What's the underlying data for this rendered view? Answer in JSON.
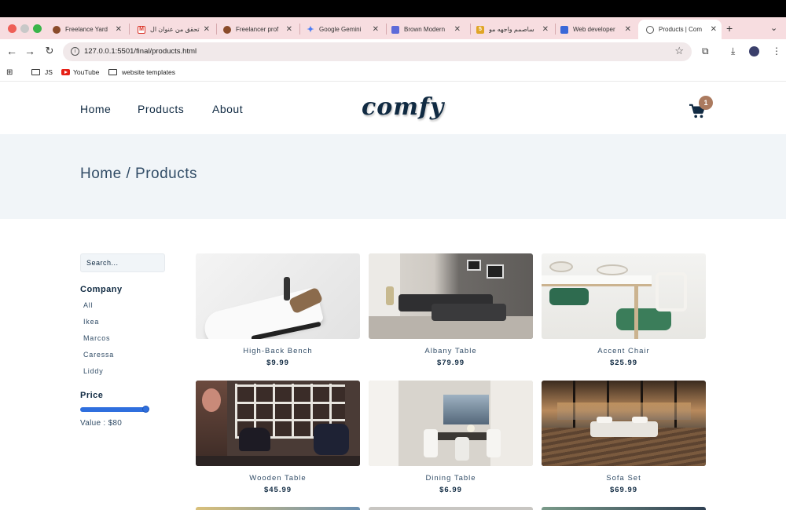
{
  "browser": {
    "tabs": [
      {
        "title": "Freelance Yard",
        "favicon_color": "#8a4b2a"
      },
      {
        "title": "تحقق من عنوان ال",
        "favicon_color": "#d93025"
      },
      {
        "title": "Freelancer prof",
        "favicon_color": "#8a4b2a"
      },
      {
        "title": "Google Gemini",
        "favicon_color": "#4a7cf5"
      },
      {
        "title": "Brown Modern",
        "favicon_color": "#5d6bd9"
      },
      {
        "title": "ساصمم واجهه مو",
        "favicon_color": "#e0a526"
      },
      {
        "title": "Web developer",
        "favicon_color": "#3a68d8"
      },
      {
        "title": "Products | Com",
        "favicon_color": "#555555"
      }
    ],
    "url": "127.0.0.1:5501/final/products.html",
    "bookmarks": [
      "JS",
      "YouTube",
      "website templates"
    ]
  },
  "nav": {
    "links": [
      "Home",
      "Products",
      "About"
    ],
    "logo": "comfy",
    "cart_count": "1"
  },
  "hero": {
    "title": "Home / Products"
  },
  "sidebar": {
    "search_placeholder": "Search...",
    "company_title": "Company",
    "companies": [
      "All",
      "Ikea",
      "Marcos",
      "Caressa",
      "Liddy"
    ],
    "price_title": "Price",
    "price_value": "Value : $80",
    "price_level": 1.0
  },
  "products": [
    {
      "name": "High-Back Bench",
      "price": "$9.99"
    },
    {
      "name": "Albany Table",
      "price": "$79.99"
    },
    {
      "name": "Accent Chair",
      "price": "$25.99"
    },
    {
      "name": "Wooden Table",
      "price": "$45.99"
    },
    {
      "name": "Dining Table",
      "price": "$6.99"
    },
    {
      "name": "Sofa Set",
      "price": "$69.99"
    }
  ],
  "colors": {
    "primary": "#102a42",
    "accent": "#ab7a5f",
    "hero_bg": "#f1f5f8",
    "slider": "#2f6fde"
  }
}
